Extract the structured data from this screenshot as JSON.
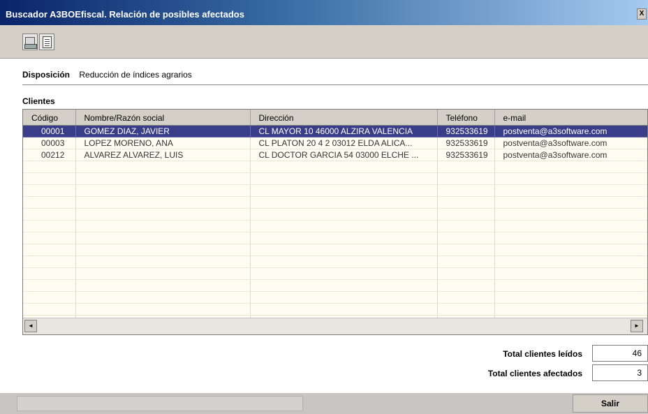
{
  "window": {
    "title": "Buscador A3BOEfiscal. Relación de posibles afectados",
    "control_glyph": "X"
  },
  "disposicion": {
    "label": "Disposición",
    "value": "Reducción de índices agrarios"
  },
  "clientes": {
    "label": "Clientes",
    "columns": [
      "Código",
      "Nombre/Razón social",
      "Dirección",
      "Teléfono",
      "e-mail"
    ],
    "rows": [
      [
        "00001",
        "GOMEZ DIAZ, JAVIER",
        "CL MAYOR 10 46000 ALZIRA VALENCIA",
        "932533619",
        "postventa@a3software.com"
      ],
      [
        "00003",
        "LOPEZ MORENO, ANA",
        "CL PLATON 20 4 2 03012 ELDA ALICA...",
        "932533619",
        "postventa@a3software.com"
      ],
      [
        "00212",
        "ALVAREZ ALVAREZ, LUIS",
        "CL DOCTOR GARCIA 54 03000 ELCHE ...",
        "932533619",
        "postventa@a3software.com"
      ]
    ],
    "selected_row": 0
  },
  "scrollbar": {
    "left_arrow": "◄",
    "right_arrow": "►"
  },
  "totals": {
    "leidos_label": "Total clientes leídos",
    "leidos_value": "46",
    "afectados_label": "Total clientes afectados",
    "afectados_value": "3"
  },
  "footer": {
    "salir_label": "Salir"
  },
  "icons": {
    "toolbar": [
      "printer-icon",
      "preview-icon"
    ]
  },
  "colors": {
    "selection": "#3a3d88",
    "grid_background": "#fffdf1",
    "titlebar_start": "#0a246a"
  }
}
